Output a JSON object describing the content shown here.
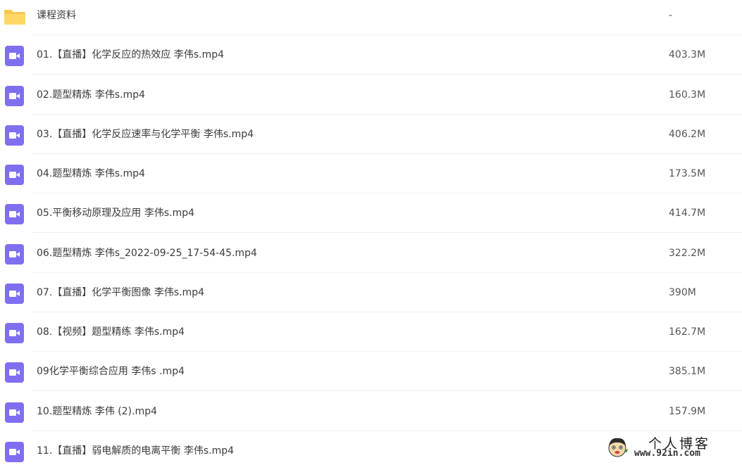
{
  "colors": {
    "folder": "#f7c84d",
    "video_icon": "#7f6ff0",
    "text": "#3b3b3b",
    "separator": "#f0f0f0"
  },
  "files": [
    {
      "name": "课程资料",
      "size": "-",
      "icon": "folder-icon"
    },
    {
      "name": "01.【直播】化学反应的热效应 李伟s.mp4",
      "size": "403.3M",
      "icon": "video-file-icon"
    },
    {
      "name": "02.题型精炼 李伟s.mp4",
      "size": "160.3M",
      "icon": "video-file-icon"
    },
    {
      "name": "03.【直播】化学反应速率与化学平衡 李伟s.mp4",
      "size": "406.2M",
      "icon": "video-file-icon"
    },
    {
      "name": "04.题型精炼 李伟s.mp4",
      "size": "173.5M",
      "icon": "video-file-icon"
    },
    {
      "name": "05.平衡移动原理及应用 李伟s.mp4",
      "size": "414.7M",
      "icon": "video-file-icon"
    },
    {
      "name": "06.题型精炼 李伟s_2022-09-25_17-54-45.mp4",
      "size": "322.2M",
      "icon": "video-file-icon"
    },
    {
      "name": "07.【直播】化学平衡图像 李伟s.mp4",
      "size": "390M",
      "icon": "video-file-icon"
    },
    {
      "name": "08.【视频】题型精练 李伟s.mp4",
      "size": "162.7M",
      "icon": "video-file-icon"
    },
    {
      "name": "09化学平衡综合应用 李伟s .mp4",
      "size": "385.1M",
      "icon": "video-file-icon"
    },
    {
      "name": "10.题型精炼 李伟 (2).mp4",
      "size": "157.9M",
      "icon": "video-file-icon"
    },
    {
      "name": "11.【直播】弱电解质的电离平衡 李伟s.mp4",
      "size": "",
      "icon": "video-file-icon"
    }
  ],
  "watermark": {
    "title": "个人博客",
    "url": "www.92in.com",
    "icon": "cartoon-face-icon"
  }
}
